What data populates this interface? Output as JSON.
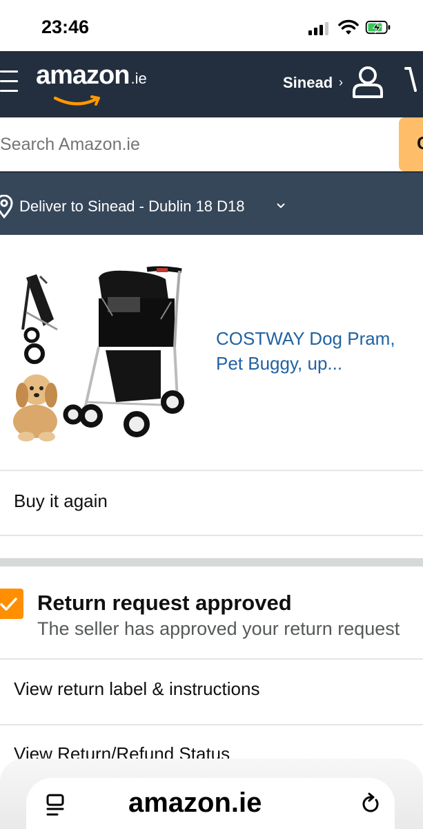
{
  "status_bar": {
    "time": "23:46"
  },
  "header": {
    "logo_word": "amazon",
    "logo_tld": ".ie",
    "account_name": "Sinead",
    "account_chevron": "›",
    "icons": [
      "menu-icon",
      "user-icon",
      "cart-icon"
    ]
  },
  "search": {
    "placeholder": "Search Amazon.ie"
  },
  "deliver": {
    "text": "Deliver to Sinead - Dublin 18 D18"
  },
  "product": {
    "title": "COSTWAY Dog Pram, Pet Buggy, up..."
  },
  "actions": {
    "buy_again": "Buy it again",
    "view_label": "View return label & instructions",
    "view_status": "View Return/Refund Status"
  },
  "return_request": {
    "title": "Return request approved",
    "subtitle": "The seller has approved your return request"
  },
  "browser": {
    "url": "amazon.ie"
  },
  "colors": {
    "header_bg": "#232f3e",
    "deliver_bg": "#37475a",
    "accent_orange": "#ff9900",
    "link_blue": "#2162a1",
    "search_button": "#febd69"
  }
}
